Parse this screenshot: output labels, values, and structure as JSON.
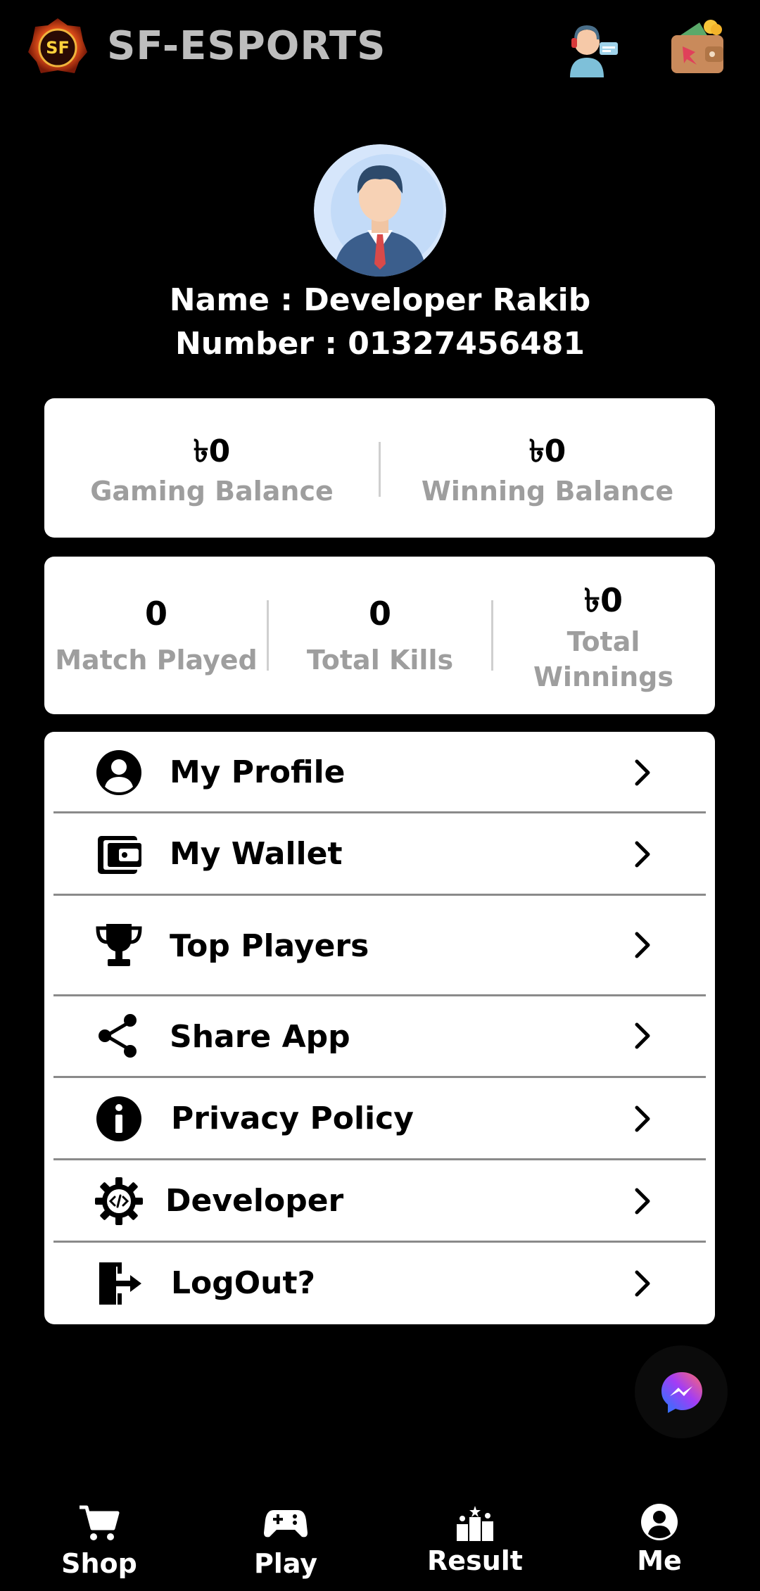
{
  "header": {
    "logo_text": "SF",
    "title": "SF-ESPORTS",
    "icons": [
      "logo-icon",
      "support-icon",
      "wallet-icon"
    ]
  },
  "profile": {
    "name_line": "Name : Developer Rakib",
    "number_line": "Number : 01327456481"
  },
  "balances": [
    {
      "amount": "৳0",
      "label": "Gaming Balance"
    },
    {
      "amount": "৳0",
      "label": "Winning Balance"
    }
  ],
  "stats": [
    {
      "value": "0",
      "label": "Match Played"
    },
    {
      "value": "0",
      "label": "Total Kills"
    },
    {
      "value": "৳0",
      "label_line1": "Total",
      "label_line2": "Winnings"
    }
  ],
  "menu": [
    {
      "label": "My Profile",
      "icon": "user-circle-icon"
    },
    {
      "label": "My Wallet",
      "icon": "wallet-icon"
    },
    {
      "label": "Top Players",
      "icon": "trophy-icon"
    },
    {
      "label": "Share App",
      "icon": "share-icon"
    },
    {
      "label": "Privacy Policy",
      "icon": "info-icon"
    },
    {
      "label": "Developer",
      "icon": "developer-gear-icon"
    },
    {
      "label": "LogOut?",
      "icon": "logout-icon"
    }
  ],
  "bottom_nav": [
    {
      "label": "Shop",
      "icon": "cart-icon"
    },
    {
      "label": "Play",
      "icon": "gamepad-icon"
    },
    {
      "label": "Result",
      "icon": "podium-icon"
    },
    {
      "label": "Me",
      "icon": "user-icon"
    }
  ],
  "colors": {
    "background": "#000000",
    "card": "#ffffff",
    "muted_text": "#9e9e9e",
    "title_text": "#bdbdbd"
  }
}
